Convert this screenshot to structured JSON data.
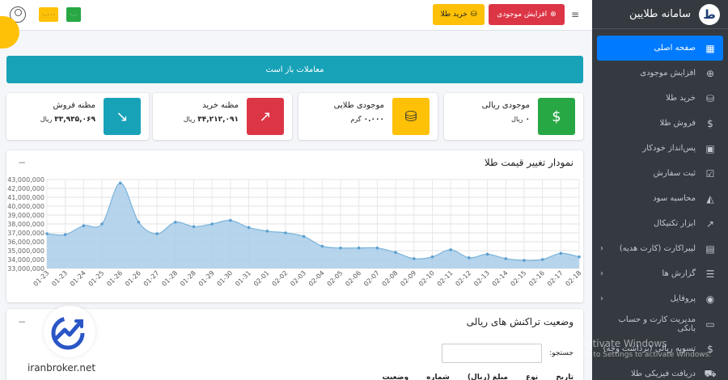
{
  "sidebar": {
    "brand_logo": "ط",
    "brand": "سامانه طلایین",
    "items": [
      {
        "label": "صفحه اصلی",
        "icon": "grid-icon",
        "glyph": "▦",
        "arrow": ""
      },
      {
        "label": "افزایش موجودی",
        "icon": "plus-circle-icon",
        "glyph": "⊕",
        "arrow": ""
      },
      {
        "label": "خرید طلا",
        "icon": "coins-icon",
        "glyph": "⛁",
        "arrow": ""
      },
      {
        "label": "فروش طلا",
        "icon": "money-bag-icon",
        "glyph": "$",
        "arrow": ""
      },
      {
        "label": "پس‌انداز خودکار",
        "icon": "piggy-bank-icon",
        "glyph": "▣",
        "arrow": ""
      },
      {
        "label": "ثبت سفارش",
        "icon": "clipboard-check-icon",
        "glyph": "☑",
        "arrow": ""
      },
      {
        "label": "محاسبه سود",
        "icon": "area-chart-icon",
        "glyph": "◭",
        "arrow": ""
      },
      {
        "label": "ابزار تکنیکال",
        "icon": "line-chart-icon",
        "glyph": "↗",
        "arrow": ""
      },
      {
        "label": "لیبراکارت (کارت هدیه)",
        "icon": "gift-icon",
        "glyph": "▤",
        "arrow": "‹"
      },
      {
        "label": "گزارش ها",
        "icon": "list-icon",
        "glyph": "☰",
        "arrow": "‹"
      },
      {
        "label": "پروفایل",
        "icon": "user-circle-icon",
        "glyph": "◉",
        "arrow": "‹"
      },
      {
        "label": "مدیریت کارت و حساب بانکی",
        "icon": "bank-card-icon",
        "glyph": "▭",
        "arrow": ""
      },
      {
        "label": "تسویه ریالی (برداشت وجه)",
        "icon": "dollar-circle-icon",
        "glyph": "$",
        "arrow": ""
      },
      {
        "label": "دریافت فیزیکی طلا",
        "icon": "truck-icon",
        "glyph": "⛟",
        "arrow": ""
      }
    ]
  },
  "topbar": {
    "badge_yellow": "۰.۰۰۰",
    "badge_green": "۰.۰",
    "buy_gold": "خرید طلا",
    "add_balance": "افزایش موجودی",
    "menu_glyph": "≡"
  },
  "banner": "معاملات باز است",
  "info_boxes": [
    {
      "title": "موجودی ریالی",
      "value": "۰",
      "unit": "ریال",
      "color": "#28a745",
      "icon": "cash-icon",
      "glyph": "$"
    },
    {
      "title": "موجودی طلایی",
      "value": "۰.۰۰۰",
      "unit": "گرم",
      "color": "#ffc107",
      "icon": "coins-stack-icon",
      "glyph": "⛁"
    },
    {
      "title": "مظنه خرید",
      "value": "۳۴,۲۱۲,۰۹۱",
      "unit": "ریال",
      "color": "#dc3545",
      "icon": "trend-up-icon",
      "glyph": "↗"
    },
    {
      "title": "مظنه فروش",
      "value": "۳۳,۹۳۵,۰۶۹",
      "unit": "ریال",
      "color": "#17a2b8",
      "icon": "trend-down-icon",
      "glyph": "↘"
    }
  ],
  "chart_card": {
    "title": "نمودار تغییر قیمت طلا",
    "tool": "−"
  },
  "chart_data": {
    "type": "area",
    "title": "",
    "xlabel": "",
    "ylabel": "",
    "ylim": [
      33000000,
      43000000
    ],
    "yticks": [
      "33,000,000",
      "34,000,000",
      "35,000,000",
      "36,000,000",
      "37,000,000",
      "38,000,000",
      "39,000,000",
      "40,000,000",
      "41,000,000",
      "42,000,000",
      "43,000,000"
    ],
    "x": [
      "01-23",
      "01-23",
      "01-24",
      "01-25",
      "01-26",
      "01-26",
      "01-27",
      "01-28",
      "01-28",
      "01-29",
      "01-30",
      "01-31",
      "02-01",
      "02-02",
      "02-03",
      "02-04",
      "02-05",
      "02-06",
      "02-07",
      "02-08",
      "02-09",
      "02-10",
      "02-11",
      "02-12",
      "02-13",
      "02-14",
      "02-15",
      "02-16",
      "02-17",
      "02-18"
    ],
    "values": [
      36900000,
      36800000,
      37800000,
      38000000,
      42600000,
      38200000,
      36900000,
      38200000,
      37700000,
      38000000,
      38400000,
      37600000,
      37200000,
      37000000,
      36600000,
      35500000,
      35300000,
      35300000,
      35300000,
      34800000,
      34100000,
      34300000,
      35100000,
      34200000,
      34600000,
      34100000,
      33900000,
      34000000,
      34700000,
      34300000
    ],
    "color": "#79b4dc",
    "grid": true,
    "legend": "none"
  },
  "tx_card": {
    "title": "وضعیت تراکنش های ریالی",
    "search_label": "جستجو:",
    "columns": [
      "تاریخ",
      "نوع",
      "مبلغ (ریال)",
      "شماره",
      "وضعیت"
    ]
  },
  "watermark": {
    "text": "iranbroker.net"
  },
  "os_overlay": {
    "line1": "Activate Windows",
    "line2": "Go to Settings to activate Windows."
  }
}
